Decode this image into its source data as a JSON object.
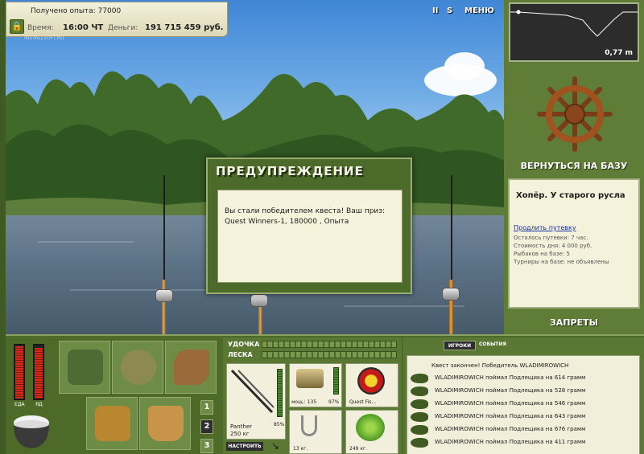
{
  "info": {
    "xp": "Получено опыта: 77000",
    "time_label": "Время:",
    "time_value": "16:00 ЧТ",
    "money_label": "Деньги:",
    "money_value": "191 715 459 руб.",
    "watermark": "INSTALLSOFT.RU"
  },
  "top_controls": {
    "pause": "II",
    "sound": "S",
    "menu": "МЕНЮ"
  },
  "depth": {
    "value": "0,77 m"
  },
  "right_panel": {
    "back_to_base": "ВЕРНУТЬСЯ НА БАЗУ",
    "location_title": "Хопёр. У старого русла",
    "extend_link": "Продлить путевку",
    "lines": [
      "Осталось путевки: 7 час.",
      "Стоимость дня: 4 000 руб.",
      "Рыбаков на базе: 5",
      "Турниры на базе: не объявлены"
    ],
    "bans": "ЗАПРЕТЫ"
  },
  "dialog": {
    "title": "ПРЕДУПРЕЖДЕНИЕ",
    "message": "Вы стали победителем квеста! Ваш приз: Quest Winners-1, 180000 , Опыта"
  },
  "bottom": {
    "food_label": "ЕДА",
    "poison_label": "ЯД",
    "food_level": 0.95,
    "poison_level": 0.92,
    "slot_numbers": [
      "1",
      "2",
      "3"
    ],
    "rod_label": "УДОЧКА",
    "line_label": "ЛЕСКА",
    "rod_name": "Panther",
    "rod_weight": "250 кг",
    "rod_percent": "85%",
    "reel_text": "мощ.: 135",
    "reel_percent": "97%",
    "line_name": "Quest Fis...",
    "hook_weight": "13 кг.",
    "bait_weight": "249 кг.",
    "setup_button": "НАСТРОИТЬ",
    "tabs": {
      "players": "ИГРОКИ",
      "events": "СОБЫТИЯ"
    },
    "events_head": "Квест закончен! Победитель WLADIMIROWICH",
    "events": [
      "WLADIMIROWICH поймал Подлещика на 614 грамм",
      "WLADIMIROWICH поймал Подлещика на 528 грамм",
      "WLADIMIROWICH поймал Подлещика на 546 грамм",
      "WLADIMIROWICH поймал Подлещика на 643 грамм",
      "WLADIMIROWICH поймал Подлещика на 676 грамм",
      "WLADIMIROWICH поймал Подлещика на 411 грамм"
    ]
  },
  "colors": {
    "panel_green": "#4d6a28",
    "dialog_green": "#4c6b2a",
    "paper": "#f5f3dc",
    "meter_red": "#d42b1a"
  }
}
